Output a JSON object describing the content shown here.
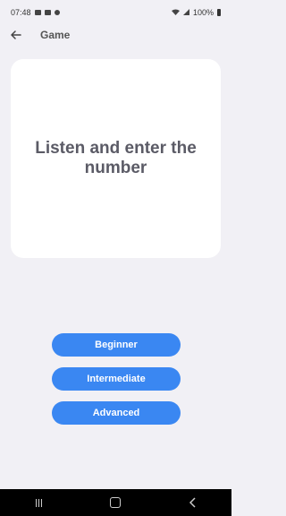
{
  "status_bar": {
    "time": "07:48",
    "battery": "100%"
  },
  "header": {
    "back_icon": "arrow-left-icon",
    "title": "Game"
  },
  "card": {
    "text": "Listen and enter the number"
  },
  "buttons": {
    "beginner": "Beginner",
    "intermediate": "Intermediate",
    "advanced": "Advanced"
  },
  "colors": {
    "background": "#f1f0f5",
    "card": "#ffffff",
    "button": "#3a87f2",
    "navbar": "#000000"
  }
}
